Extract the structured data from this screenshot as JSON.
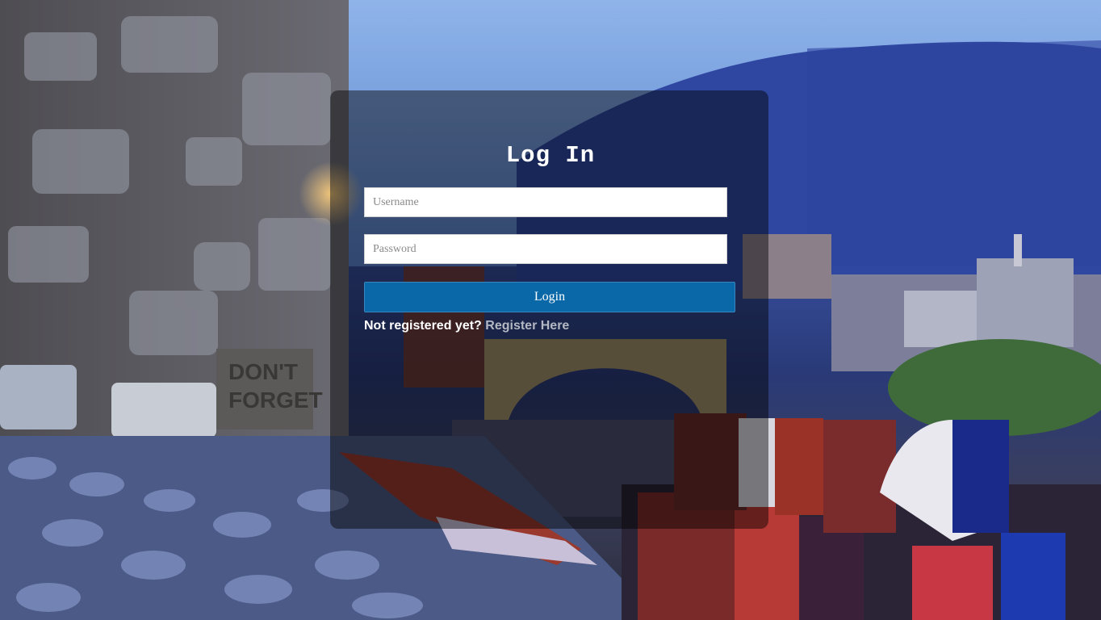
{
  "login": {
    "title": "Log In",
    "username_placeholder": "Username",
    "password_placeholder": "Password",
    "submit_label": "Login",
    "register_prompt": "Not registered yet?",
    "register_link": "Register Here"
  },
  "background": {
    "sign_text": "DON'T FORGET"
  },
  "colors": {
    "panel_overlay": "#000000",
    "button": "#0a67a8",
    "link": "#b4b8c2",
    "text": "#ffffff"
  }
}
